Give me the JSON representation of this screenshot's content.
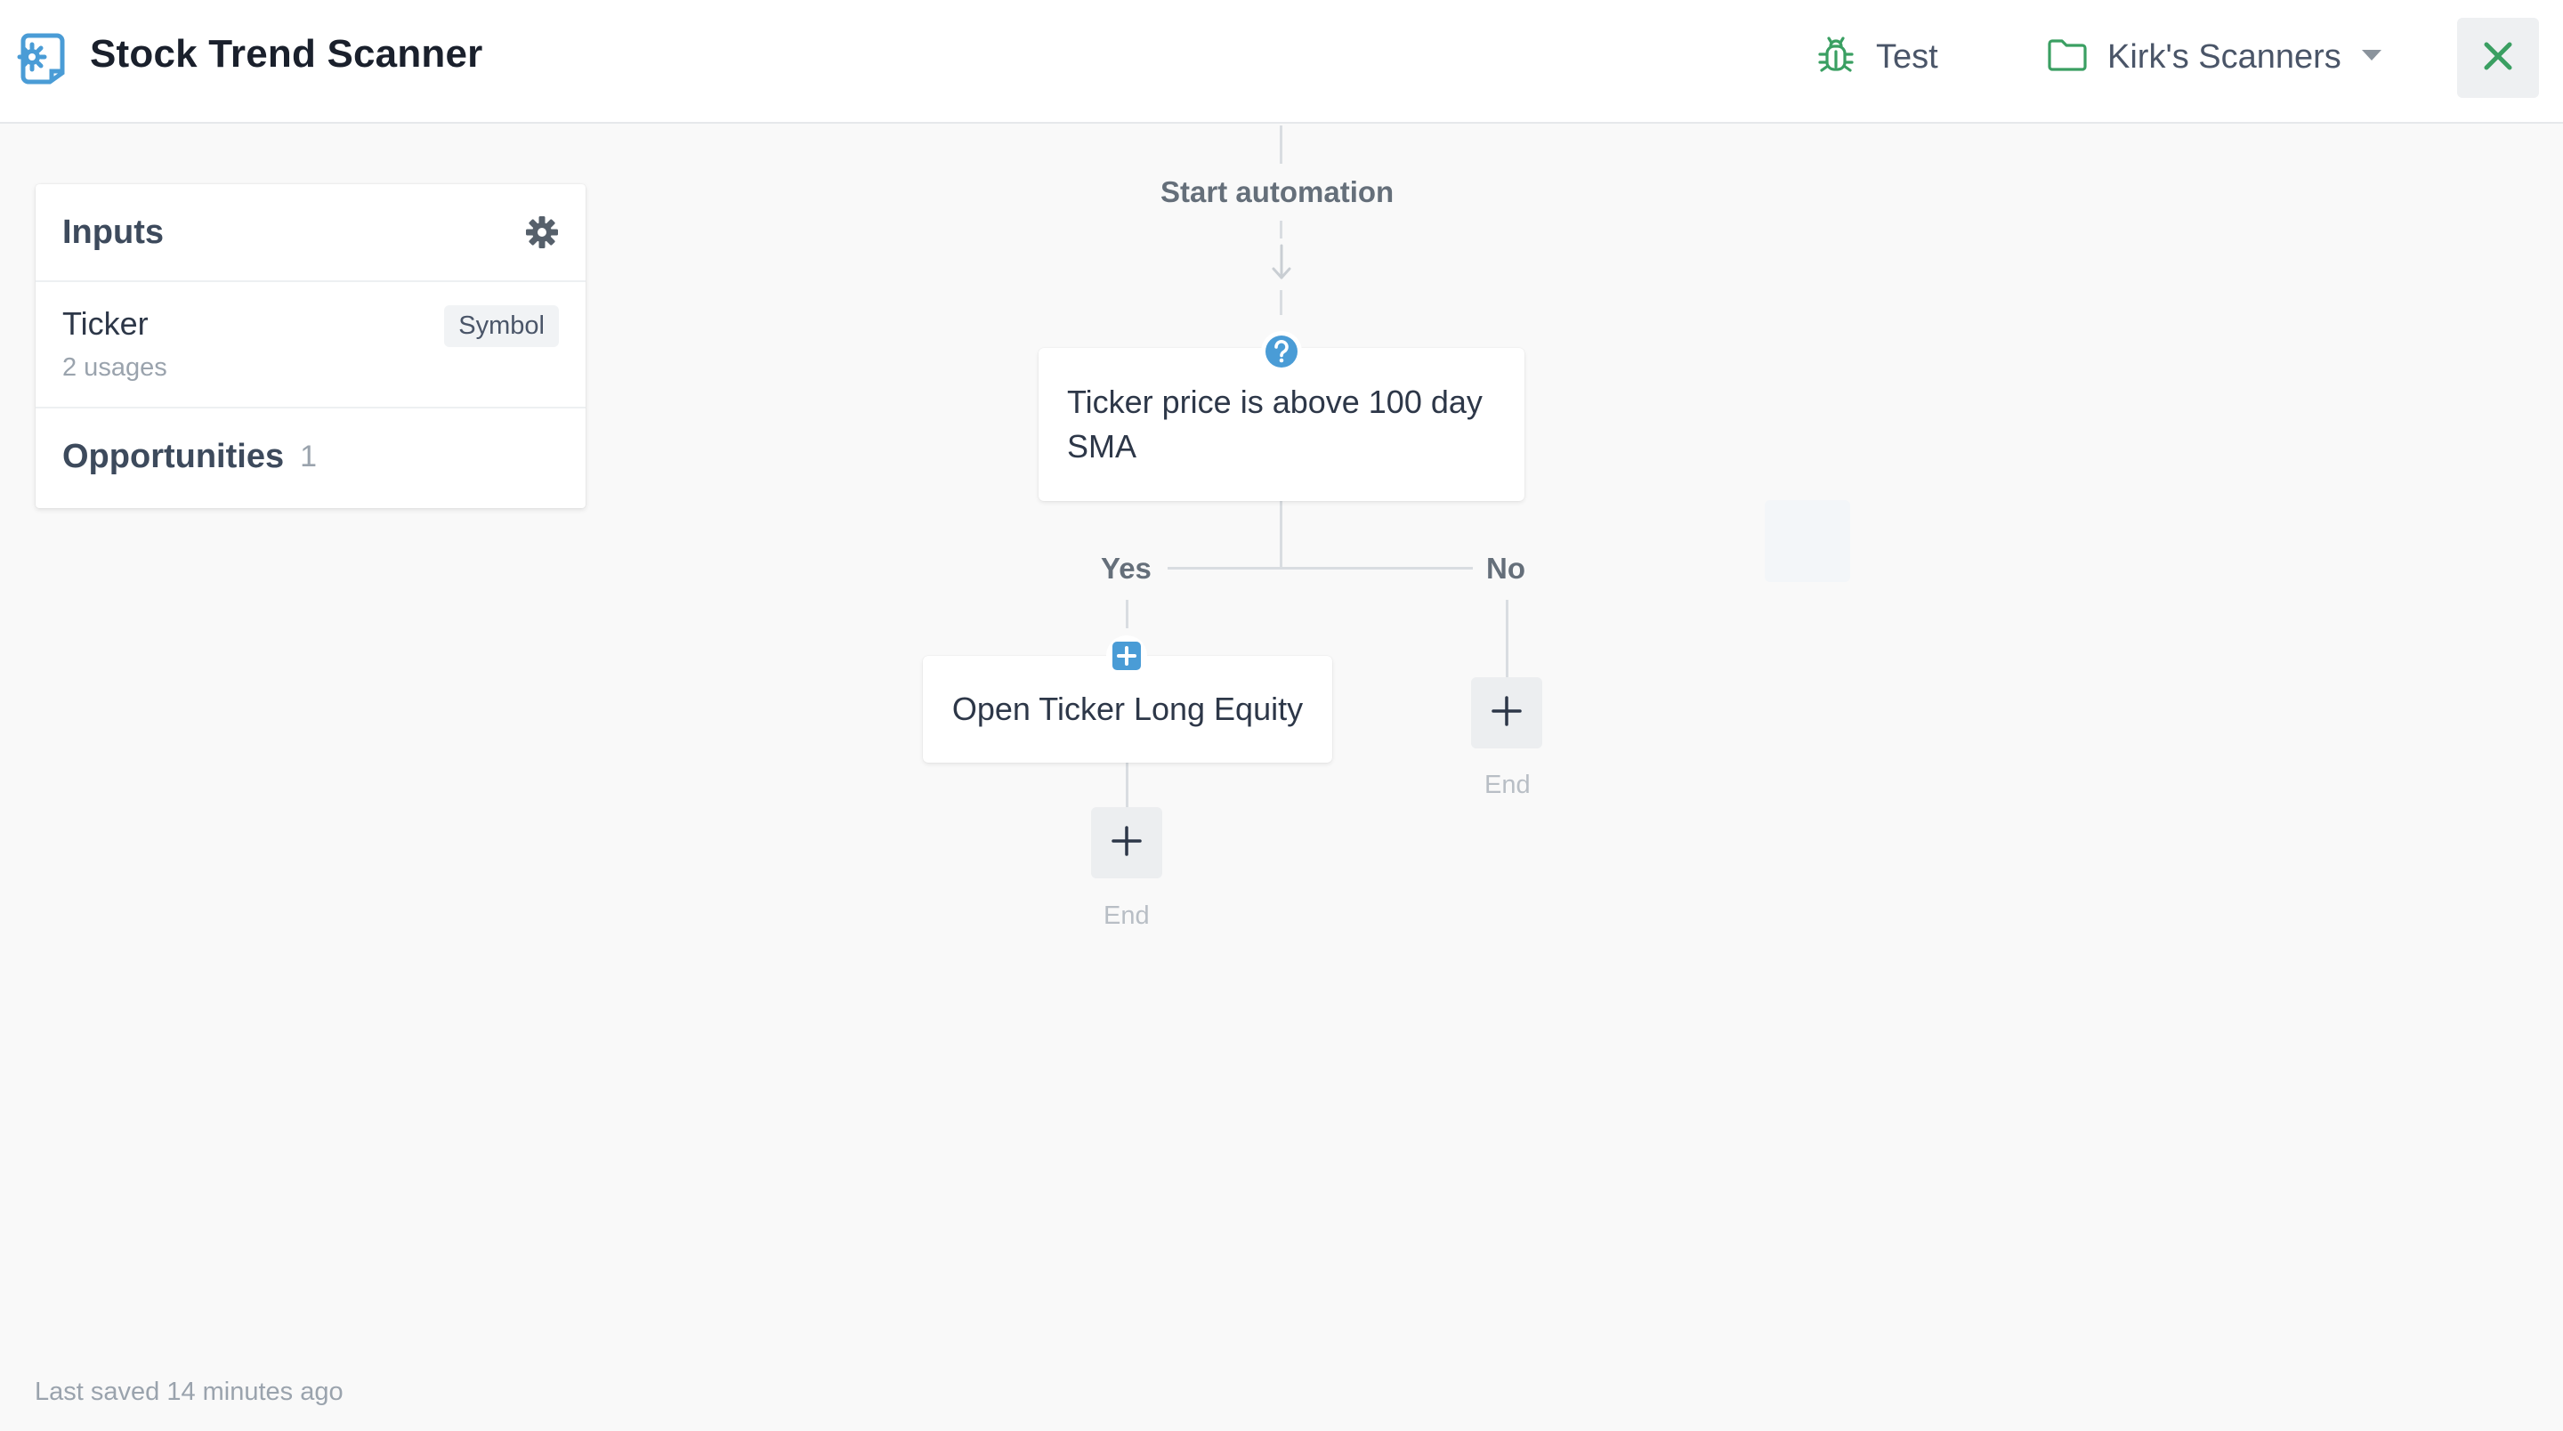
{
  "header": {
    "title": "Stock Trend Scanner",
    "test_label": "Test",
    "folder_label": "Kirk's Scanners",
    "accent_color": "#4a9cd6",
    "green_color": "#3a9f62"
  },
  "inputs_panel": {
    "title": "Inputs",
    "items": [
      {
        "name": "Ticker",
        "usages": "2 usages",
        "type": "Symbol"
      }
    ],
    "opportunities": {
      "label": "Opportunities",
      "count": "1"
    }
  },
  "flow": {
    "start_label": "Start automation",
    "condition": {
      "text_line1": "Ticker price is above 100 day",
      "text_line2": "SMA"
    },
    "yes_label": "Yes",
    "no_label": "No",
    "yes_action": {
      "text": "Open Ticker Long Equity"
    },
    "end_label_yes": "End",
    "end_label_no": "End"
  },
  "footer": {
    "status": "Last saved 14 minutes ago"
  }
}
